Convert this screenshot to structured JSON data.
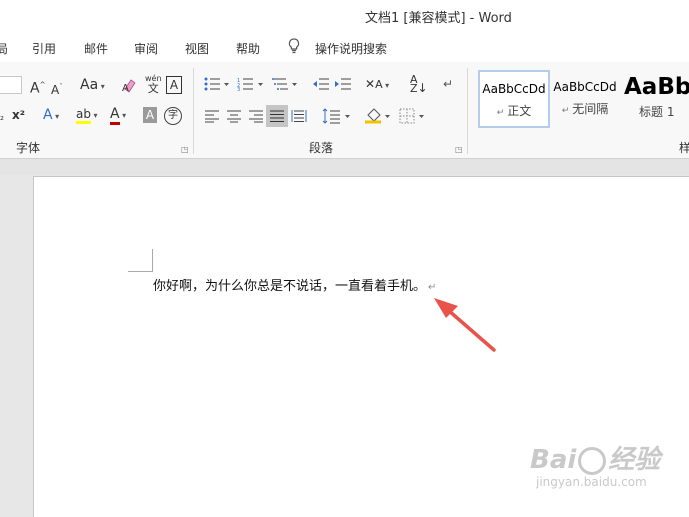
{
  "window": {
    "title": "文档1 [兼容模式]  -  Word"
  },
  "menu": {
    "partial_item": "局",
    "items": [
      "引用",
      "邮件",
      "审阅",
      "视图",
      "帮助"
    ],
    "tell_me": "操作说明搜索"
  },
  "ribbon": {
    "font": {
      "label": "字体",
      "grow_label": "A",
      "shrink_label": "A",
      "change_case_label": "Aa",
      "phonetic_top": "wén",
      "phonetic_bottom": "文",
      "border_char": "A",
      "superscript_label": "x²",
      "text_effect_label": "A",
      "highlight_label": "ab",
      "font_color_label": "A",
      "shading_label": "A",
      "enclose_label": "字",
      "font_color": "#c00000",
      "highlight_color": "#ffff00"
    },
    "paragraph": {
      "label": "段落"
    },
    "styles": {
      "partial_label": "样",
      "items": [
        {
          "sample": "AaBbCcDd",
          "name": "正文",
          "selected": true
        },
        {
          "sample": "AaBbCcDd",
          "name": "无间隔",
          "selected": false
        },
        {
          "sample": "AaBb",
          "name": "标题 1",
          "selected": false
        }
      ]
    }
  },
  "document": {
    "text": "你好啊，为什么你总是不说话，一直看着手机。",
    "paragraph_mark": "↵"
  },
  "annotation": {
    "arrow_color": "#e8534a"
  },
  "watermark": {
    "main": "Bai",
    "main2": "经验",
    "sub": "jingyan.baidu.com"
  }
}
